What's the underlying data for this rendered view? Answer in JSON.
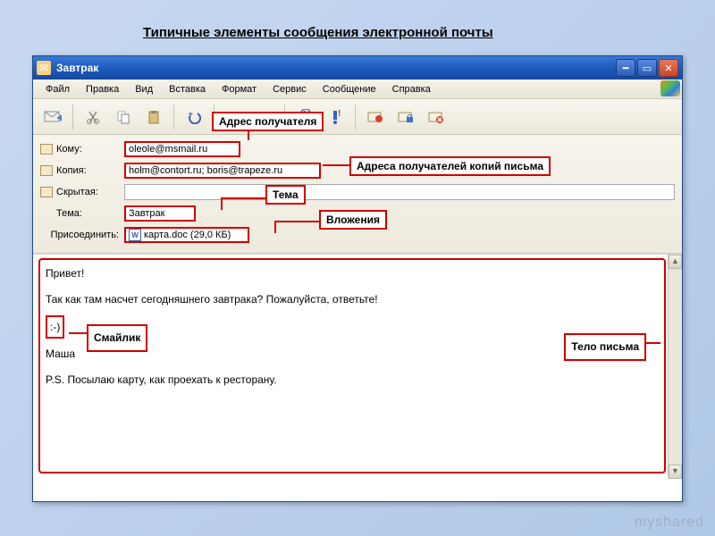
{
  "slide_title": "Типичные элементы сообщения электронной почты",
  "window": {
    "title": "Завтрак"
  },
  "menu": [
    "Файл",
    "Правка",
    "Вид",
    "Вставка",
    "Формат",
    "Сервис",
    "Сообщение",
    "Справка"
  ],
  "toolbar_icons": [
    "send",
    "cut",
    "copy",
    "paste",
    "undo",
    "check",
    "spell",
    "attach",
    "priority",
    "sign",
    "encrypt",
    "offline"
  ],
  "fields": {
    "to_label": "Кому:",
    "to_value": "oleole@msmail.ru",
    "cc_label": "Копия:",
    "cc_value": "holm@contort.ru; boris@trapeze.ru",
    "bcc_label": "Скрытая:",
    "bcc_value": "",
    "subject_label": "Тема:",
    "subject_value": "Завтрак",
    "attach_label": "Присоединить:",
    "attach_value": "карта.doc (29,0 КБ)"
  },
  "body": {
    "line1": "Привет!",
    "line2": "Так как там насчет сегодняшнего завтрака? Пожалуйста, ответьте!",
    "smiley": ":-)",
    "line4": "Маша",
    "line5": "P.S. Посылаю карту, как проехать к ресторану."
  },
  "callouts": {
    "recipient": "Адрес получателя",
    "cc": "Адреса получателей копий письма",
    "subject_c": "Тема",
    "attachments": "Вложения",
    "smiley_c": "Смайлик",
    "body_c": "Тело письма"
  },
  "watermark": "myshared"
}
